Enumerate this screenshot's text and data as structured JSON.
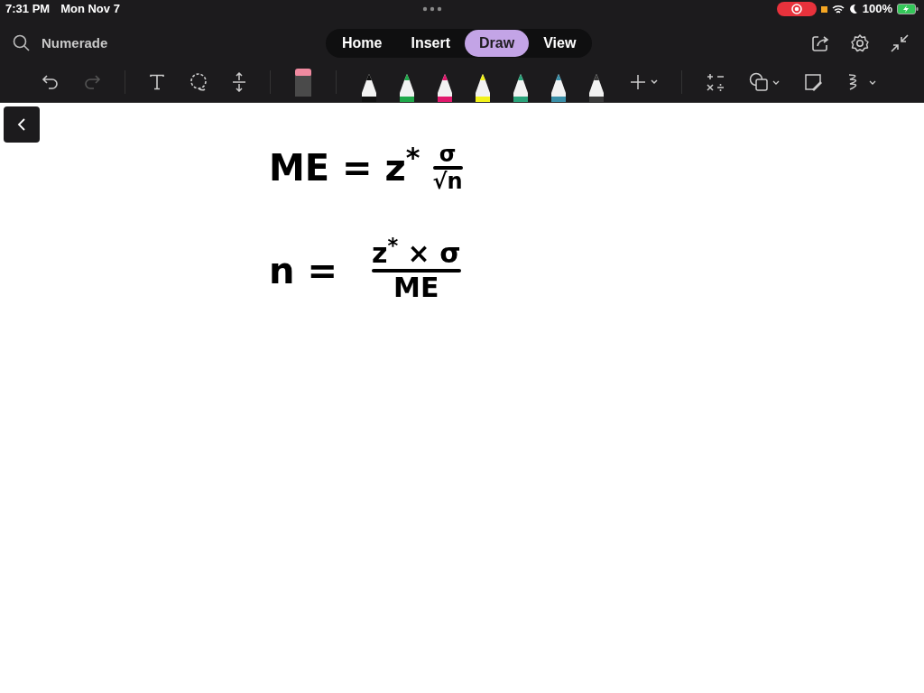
{
  "status_bar": {
    "time": "7:31 PM",
    "date": "Mon Nov 7",
    "battery": "100%"
  },
  "search": {
    "placeholder": "Numerade"
  },
  "tabs": [
    {
      "label": "Home",
      "selected": false
    },
    {
      "label": "Insert",
      "selected": false
    },
    {
      "label": "Draw",
      "selected": true
    },
    {
      "label": "View",
      "selected": false
    }
  ],
  "pens": [
    {
      "color": "#111111"
    },
    {
      "color": "#1fa84a"
    },
    {
      "color": "#e0186c"
    },
    {
      "color": "#f2f21a"
    },
    {
      "color": "#2aa37a"
    },
    {
      "color": "#3a8fa8"
    },
    {
      "color": "#3a3a3a"
    }
  ],
  "equations": [
    {
      "lhs": "ME =",
      "factor": "z$^{*}$",
      "numerator": "σ",
      "denominator": "√n"
    },
    {
      "lhs": "n =",
      "numerator": "z$^{*}$ × σ",
      "denominator": "ME"
    }
  ]
}
